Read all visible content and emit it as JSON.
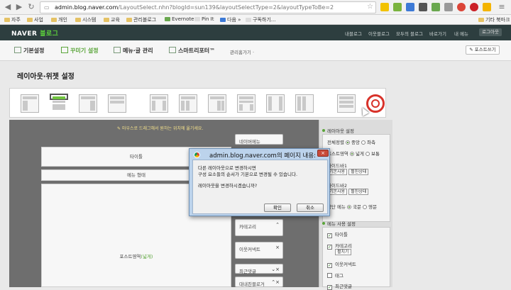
{
  "browser": {
    "url_host": "admin.blog.naver.com",
    "url_rest": "/LayoutSelect.nhn?blogId=sun139&layoutSelectType=2&layoutTypeToBe=2"
  },
  "bookmarks": {
    "items": [
      "자주",
      "사업",
      "개인",
      "시스템",
      "교육",
      "관리블로그",
      "Evernote",
      "Pin It",
      "다음 »",
      "구독하기..."
    ],
    "other": "기타 북마크"
  },
  "header": {
    "logo": "NAVER",
    "logo_suffix": "블로그",
    "links": [
      "내블로그",
      "이웃블로그",
      "모두의 블로그",
      "바로가기",
      "내 메뉴"
    ],
    "logout": "로그아웃"
  },
  "tabs": {
    "items": [
      {
        "label": "기본설정"
      },
      {
        "label": "꾸미기 설정"
      },
      {
        "label": "메뉴·글 관리"
      },
      {
        "label": "스마트리포터™"
      }
    ],
    "extra": "관리홈가기 ·",
    "post_write": "포스트쓰기"
  },
  "page_title": "레이아웃·위젯 설정",
  "work": {
    "hint": "마우스로 드래그해서 원하는 위치에 옮기세요.",
    "title_block": "타이틀",
    "menu_block": "메뉴 형태",
    "post_block": "포스트영역",
    "post_block_suffix": "(넓게)",
    "widgets": [
      "네이버메뉴",
      "카테고리",
      "이웃커넥트",
      "최근댓글",
      "대내친블로거"
    ]
  },
  "panel": {
    "layout_header": "레이아웃 설정",
    "align_label": "전체정렬",
    "align_options": [
      "중앙",
      "좌측"
    ],
    "post_area_label": "포스트영역",
    "post_area_options": [
      "넓게",
      "보통"
    ],
    "sidebar1": "사이드바1",
    "sidebar1_values": [
      "기본사용",
      "펼친상태"
    ],
    "sidebar2": "사이드바2",
    "sidebar2_values": [
      "기본사용",
      "펼친상태"
    ],
    "top_menu_label": "상단 메뉴",
    "top_menu_options": [
      "국문",
      "영문"
    ],
    "menu_use_header": "메뉴 사용 설정",
    "menu_items": [
      {
        "label": "타이틀",
        "checked": true
      },
      {
        "label": "카테고리",
        "checked": true,
        "sub": "펼치기"
      },
      {
        "label": "이웃커넥트",
        "checked": true
      },
      {
        "label": "태그",
        "checked": false
      },
      {
        "label": "최근댓글",
        "checked": true
      }
    ]
  },
  "dialog": {
    "title": "admin.blog.naver.com의 페이지 내용:",
    "line1": "다른 레이아웃으로 변경하시면",
    "line2": "구성 요소들의 순서가 기본으로 변경될 수 있습니다.",
    "line3": "레이아웃을 변경하시겠습니까?",
    "ok": "확인",
    "cancel": "취소",
    "close": "×"
  }
}
